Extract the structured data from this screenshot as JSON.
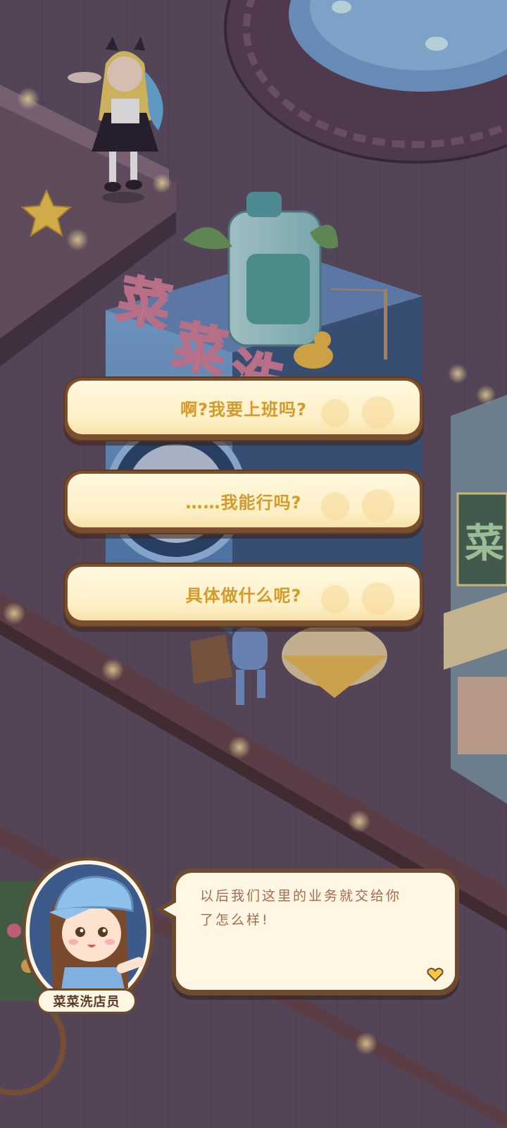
{
  "choices": [
    {
      "label": "啊?我要上班吗?"
    },
    {
      "label": "……我能行吗?"
    },
    {
      "label": "具体做什么呢?"
    }
  ],
  "dialog": {
    "speaker": "菜菜洗店员",
    "text_line1": "以后我们这里的业务就交给你",
    "text_line2": "了怎么样!"
  },
  "colors": {
    "choice_text": "#d49a2b",
    "dialog_text": "#a9684d",
    "frame_brown": "#6e4a2e",
    "cream": "#fff7e3"
  },
  "scene": {
    "sign_chars": [
      "菜",
      "菜",
      "洗"
    ],
    "shop_sign_char": "菜"
  }
}
